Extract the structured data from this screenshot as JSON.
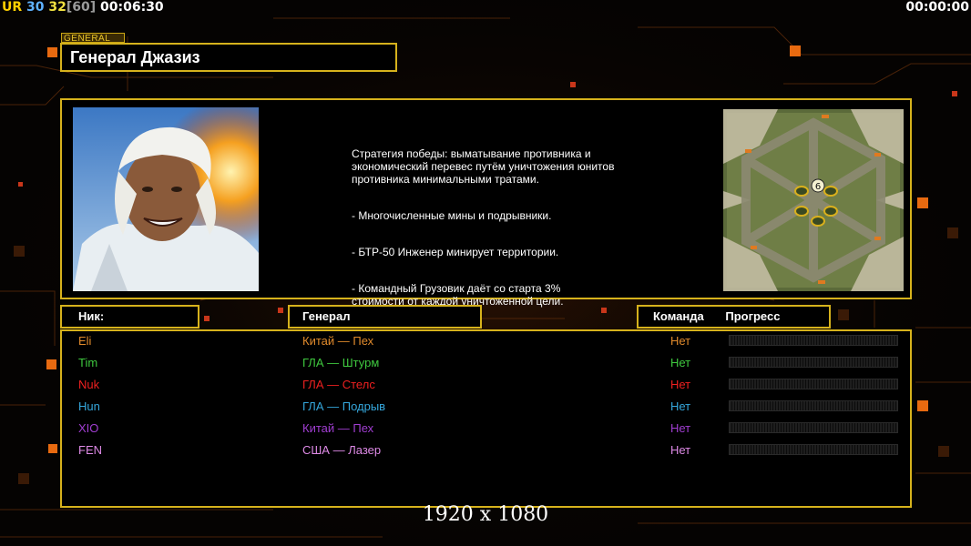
{
  "hud": {
    "ur_label": "UR",
    "fps": "30",
    "fps2": "32",
    "fps_cap": "[60]",
    "elapsed": "00:06:30",
    "timer": "00:00:00"
  },
  "general": {
    "tag": "GENERAL",
    "name": "Генерал Джазиз",
    "description": [
      "Стратегия победы: выматывание противника и\n экономический перевес путём уничтожения юнитов\n противника минимальными тратами.",
      "- Многочисленные мины и подрывники.",
      "- БТР-50 Инженер минирует территории.",
      "- Командный Грузовик даёт со старта 3%\n стоимости от каждой уничтоженной цели."
    ]
  },
  "minimap": {
    "center_label": "6"
  },
  "columns": {
    "nick": "Ник:",
    "general": "Генерал",
    "team": "Команда",
    "progress": "Прогресс"
  },
  "players": [
    {
      "nick": "Eli",
      "general": "Китай — Пех",
      "team": "Нет",
      "progress": 0,
      "color": "#e08a2c"
    },
    {
      "nick": "Tim",
      "general": "ГЛА — Штурм",
      "team": "Нет",
      "progress": 0,
      "color": "#3fc93f"
    },
    {
      "nick": "Nuk",
      "general": "ГЛА — Стелс",
      "team": "Нет",
      "progress": 0,
      "color": "#ee2020"
    },
    {
      "nick": "Hun",
      "general": "ГЛА — Подрыв",
      "team": "Нет",
      "progress": 0,
      "color": "#35a7dc"
    },
    {
      "nick": "XIO",
      "general": "Китай — Пех",
      "team": "Нет",
      "progress": 0,
      "color": "#a13ed2"
    },
    {
      "nick": "FEN",
      "general": "США — Лазер",
      "team": "Нет",
      "progress": 0,
      "color": "#de8ae6"
    }
  ],
  "resolution": "1920 x 1080",
  "colors": {
    "frame": "#d6b21c",
    "accent": "#ff7a10"
  }
}
